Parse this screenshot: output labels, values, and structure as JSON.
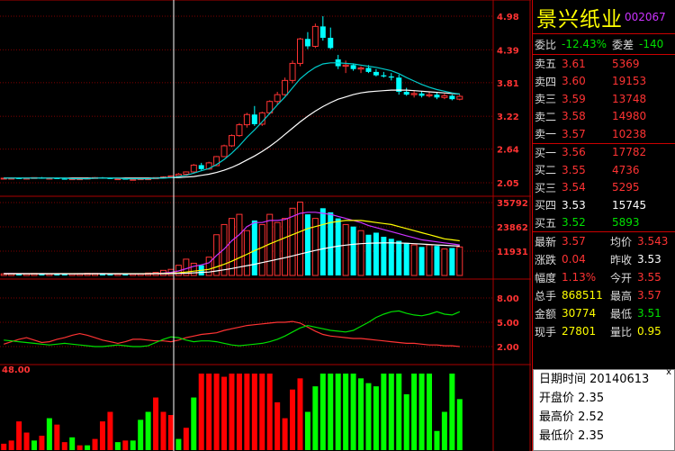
{
  "stock": {
    "name": "景兴纸业",
    "code": "002067"
  },
  "order_book": {
    "weibi_label": "委比",
    "weibi_value": "-12.43%",
    "weicha_label": "委差",
    "weicha_value": "-140",
    "asks": [
      {
        "label": "卖五",
        "price": "3.61",
        "volume": "5369"
      },
      {
        "label": "卖四",
        "price": "3.60",
        "volume": "19153"
      },
      {
        "label": "卖三",
        "price": "3.59",
        "volume": "13748"
      },
      {
        "label": "卖二",
        "price": "3.58",
        "volume": "14980"
      },
      {
        "label": "卖一",
        "price": "3.57",
        "volume": "10238"
      }
    ],
    "bids": [
      {
        "label": "买一",
        "price": "3.56",
        "volume": "17782"
      },
      {
        "label": "买二",
        "price": "3.55",
        "volume": "4736"
      },
      {
        "label": "买三",
        "price": "3.54",
        "volume": "5295"
      },
      {
        "label": "买四",
        "price": "3.53",
        "volume": "15745"
      },
      {
        "label": "买五",
        "price": "3.52",
        "volume": "5893"
      }
    ]
  },
  "quote": [
    {
      "l1": "最新",
      "v1": "3.57",
      "l2": "均价",
      "v2": "3.543"
    },
    {
      "l1": "涨跌",
      "v1": "0.04",
      "l2": "昨收",
      "v2": "3.53"
    },
    {
      "l1": "幅度",
      "v1": "1.13%",
      "l2": "今开",
      "v2": "3.55"
    },
    {
      "l1": "总手",
      "v1": "868511",
      "l2": "最高",
      "v2": "3.57"
    },
    {
      "l1": "金额",
      "v1": "30774",
      "l2": "最低",
      "v2": "3.51"
    },
    {
      "l1": "现手",
      "v1": "27801",
      "l2": "量比",
      "v2": "0.95"
    }
  ],
  "tooltip": {
    "date_label": "日期时间",
    "date_value": "20140613",
    "open_label": "开盘价",
    "open_value": "2.35",
    "high_label": "最高价",
    "high_value": "2.52",
    "low_label": "最低价",
    "low_value": "2.35",
    "close_button": "x"
  },
  "colors": {
    "up": "#ff3333",
    "down": "#00ffff",
    "grid": "#aa0000",
    "axis_text": "#ff3333",
    "ma_slow": "#ffffff",
    "ma_fast": "#00cccc"
  },
  "chart_data": [
    {
      "type": "candlestick",
      "name": "price",
      "y_ticks": [
        "4.98",
        "4.39",
        "3.81",
        "3.22",
        "2.64",
        "2.05"
      ],
      "ylim": [
        2.05,
        4.98
      ],
      "candles": [
        [
          2.12,
          2.13,
          2.11,
          2.13
        ],
        [
          2.13,
          2.14,
          2.12,
          2.13
        ],
        [
          2.13,
          2.14,
          2.12,
          2.12
        ],
        [
          2.12,
          2.13,
          2.11,
          2.13
        ],
        [
          2.13,
          2.14,
          2.12,
          2.14
        ],
        [
          2.14,
          2.15,
          2.12,
          2.12
        ],
        [
          2.12,
          2.14,
          2.11,
          2.13
        ],
        [
          2.13,
          2.14,
          2.12,
          2.12
        ],
        [
          2.12,
          2.13,
          2.11,
          2.11
        ],
        [
          2.11,
          2.13,
          2.1,
          2.12
        ],
        [
          2.12,
          2.13,
          2.11,
          2.12
        ],
        [
          2.12,
          2.14,
          2.11,
          2.13
        ],
        [
          2.13,
          2.15,
          2.12,
          2.14
        ],
        [
          2.14,
          2.15,
          2.12,
          2.13
        ],
        [
          2.13,
          2.14,
          2.12,
          2.12
        ],
        [
          2.12,
          2.13,
          2.11,
          2.12
        ],
        [
          2.12,
          2.13,
          2.11,
          2.11
        ],
        [
          2.11,
          2.12,
          2.1,
          2.11
        ],
        [
          2.11,
          2.12,
          2.1,
          2.12
        ],
        [
          2.12,
          2.13,
          2.11,
          2.12
        ],
        [
          2.12,
          2.14,
          2.12,
          2.14
        ],
        [
          2.14,
          2.16,
          2.13,
          2.15
        ],
        [
          2.15,
          2.18,
          2.14,
          2.17
        ],
        [
          2.17,
          2.22,
          2.16,
          2.2
        ],
        [
          2.2,
          2.25,
          2.19,
          2.24
        ],
        [
          2.24,
          2.38,
          2.22,
          2.36
        ],
        [
          2.36,
          2.4,
          2.27,
          2.29
        ],
        [
          2.29,
          2.42,
          2.28,
          2.4
        ],
        [
          2.35,
          2.52,
          2.35,
          2.51
        ],
        [
          2.51,
          2.72,
          2.5,
          2.7
        ],
        [
          2.7,
          2.9,
          2.68,
          2.88
        ],
        [
          2.88,
          3.1,
          2.86,
          3.07
        ],
        [
          3.07,
          3.28,
          3.02,
          3.25
        ],
        [
          3.25,
          3.4,
          3.05,
          3.08
        ],
        [
          3.08,
          3.3,
          3.05,
          3.28
        ],
        [
          3.28,
          3.5,
          3.25,
          3.48
        ],
        [
          3.48,
          3.65,
          3.42,
          3.6
        ],
        [
          3.6,
          3.9,
          3.58,
          3.85
        ],
        [
          3.85,
          4.2,
          3.8,
          4.15
        ],
        [
          4.15,
          4.6,
          4.1,
          4.58
        ],
        [
          4.58,
          4.7,
          4.4,
          4.45
        ],
        [
          4.45,
          4.85,
          4.42,
          4.8
        ],
        [
          4.8,
          4.98,
          4.55,
          4.6
        ],
        [
          4.6,
          4.78,
          4.4,
          4.42
        ],
        [
          4.22,
          4.3,
          4.05,
          4.1
        ],
        [
          4.1,
          4.2,
          3.98,
          4.12
        ],
        [
          4.12,
          4.15,
          4.02,
          4.05
        ],
        [
          4.05,
          4.1,
          3.98,
          4.07
        ],
        [
          4.07,
          4.12,
          3.98,
          4.0
        ],
        [
          4.0,
          4.05,
          3.92,
          3.94
        ],
        [
          3.94,
          4.0,
          3.9,
          3.92
        ],
        [
          3.92,
          3.98,
          3.85,
          3.9
        ],
        [
          3.9,
          3.95,
          3.6,
          3.65
        ],
        [
          3.65,
          3.72,
          3.58,
          3.6
        ],
        [
          3.6,
          3.68,
          3.55,
          3.62
        ],
        [
          3.62,
          3.66,
          3.55,
          3.58
        ],
        [
          3.58,
          3.65,
          3.55,
          3.6
        ],
        [
          3.6,
          3.64,
          3.52,
          3.55
        ],
        [
          3.55,
          3.62,
          3.52,
          3.58
        ],
        [
          3.58,
          3.6,
          3.5,
          3.52
        ],
        [
          3.52,
          3.6,
          3.5,
          3.57
        ]
      ],
      "ma_slow": [
        2.13,
        2.13,
        2.13,
        2.13,
        2.13,
        2.13,
        2.13,
        2.13,
        2.13,
        2.13,
        2.13,
        2.13,
        2.13,
        2.13,
        2.13,
        2.13,
        2.13,
        2.13,
        2.13,
        2.13,
        2.13,
        2.14,
        2.14,
        2.14,
        2.15,
        2.16,
        2.18,
        2.2,
        2.23,
        2.27,
        2.32,
        2.38,
        2.45,
        2.52,
        2.6,
        2.69,
        2.79,
        2.9,
        3.01,
        3.12,
        3.22,
        3.31,
        3.39,
        3.46,
        3.52,
        3.56,
        3.6,
        3.63,
        3.65,
        3.66,
        3.67,
        3.68,
        3.68,
        3.68,
        3.67,
        3.66,
        3.65,
        3.64,
        3.63,
        3.62,
        3.61
      ],
      "ma_fast": [
        2.13,
        2.13,
        2.13,
        2.13,
        2.13,
        2.13,
        2.13,
        2.13,
        2.13,
        2.12,
        2.12,
        2.12,
        2.13,
        2.13,
        2.13,
        2.13,
        2.12,
        2.12,
        2.12,
        2.12,
        2.13,
        2.13,
        2.14,
        2.16,
        2.18,
        2.22,
        2.26,
        2.3,
        2.37,
        2.46,
        2.57,
        2.7,
        2.85,
        2.98,
        3.12,
        3.27,
        3.42,
        3.56,
        3.72,
        3.88,
        3.99,
        4.08,
        4.14,
        4.16,
        4.16,
        4.15,
        4.14,
        4.12,
        4.1,
        4.08,
        4.05,
        4.02,
        3.97,
        3.9,
        3.84,
        3.78,
        3.73,
        3.69,
        3.66,
        3.63,
        3.61
      ]
    },
    {
      "type": "bar",
      "name": "volume",
      "y_ticks": [
        "35792",
        "23862",
        "11931"
      ],
      "ylim": [
        0,
        35792
      ],
      "values": [
        800,
        900,
        700,
        850,
        1000,
        900,
        800,
        750,
        700,
        900,
        800,
        1100,
        1000,
        900,
        800,
        700,
        750,
        800,
        900,
        1200,
        1500,
        2500,
        3000,
        5000,
        8000,
        6000,
        5000,
        9000,
        20000,
        25000,
        28000,
        30000,
        22000,
        27000,
        25000,
        30000,
        26000,
        28000,
        33000,
        36000,
        30000,
        28000,
        33000,
        31000,
        28000,
        25000,
        24000,
        22000,
        20000,
        21000,
        19000,
        18000,
        17000,
        16000,
        15000,
        14000,
        15000,
        14500,
        13000,
        13500,
        14000
      ],
      "ma1": [
        1000,
        1000,
        950,
        950,
        900,
        950,
        900,
        900,
        900,
        850,
        900,
        900,
        950,
        950,
        900,
        900,
        850,
        850,
        850,
        900,
        1000,
        1200,
        1500,
        2200,
        3300,
        4500,
        5200,
        6200,
        9800,
        13000,
        17000,
        20000,
        24000,
        26000,
        26000,
        27000,
        27000,
        27500,
        29000,
        30500,
        31000,
        31000,
        30500,
        30000,
        29000,
        28000,
        27000,
        26000,
        24500,
        23500,
        22500,
        21500,
        20500,
        19500,
        18500,
        17500,
        17000,
        16500,
        16000,
        15500,
        15000
      ],
      "ma2": [
        900,
        900,
        900,
        900,
        900,
        900,
        900,
        900,
        900,
        900,
        900,
        900,
        900,
        900,
        900,
        900,
        900,
        900,
        900,
        900,
        950,
        1000,
        1100,
        1300,
        1700,
        2100,
        2500,
        3000,
        4200,
        5500,
        7000,
        8700,
        10400,
        12200,
        13800,
        15500,
        17000,
        18500,
        20000,
        21500,
        23000,
        24000,
        25000,
        26000,
        26500,
        27000,
        27000,
        27000,
        26500,
        26000,
        25500,
        25000,
        24000,
        23000,
        22000,
        21000,
        20000,
        19000,
        18000,
        17500,
        17000
      ],
      "ma3": [
        850,
        850,
        850,
        850,
        850,
        850,
        850,
        850,
        850,
        850,
        850,
        850,
        850,
        850,
        850,
        850,
        850,
        850,
        850,
        850,
        870,
        900,
        950,
        1000,
        1100,
        1300,
        1500,
        1700,
        2200,
        2800,
        3400,
        4100,
        4800,
        5500,
        6300,
        7100,
        7900,
        8700,
        9600,
        10500,
        11400,
        12300,
        13100,
        13800,
        14400,
        14900,
        15300,
        15600,
        15800,
        15900,
        16000,
        16000,
        15900,
        15800,
        15600,
        15400,
        15200,
        15000,
        14800,
        14600,
        14400
      ]
    },
    {
      "type": "line",
      "name": "indicator",
      "y_ticks": [
        "8.00",
        "5.00",
        "2.00"
      ],
      "ylim": [
        0,
        10
      ],
      "series": [
        {
          "values": [
            2.3,
            2.6,
            2.9,
            3.1,
            2.8,
            2.5,
            2.6,
            2.9,
            3.1,
            3.4,
            3.6,
            3.4,
            3.1,
            2.8,
            2.6,
            2.4,
            2.6,
            2.9,
            2.9,
            2.8,
            2.7,
            2.7,
            2.6,
            2.8,
            3.1,
            3.3,
            3.5,
            3.6,
            3.7,
            4.0,
            4.2,
            4.4,
            4.6,
            4.7,
            4.8,
            4.9,
            5.0,
            5.0,
            5.1,
            4.9,
            4.4,
            3.9,
            3.5,
            3.3,
            3.2,
            3.1,
            3.0,
            3.0,
            2.9,
            2.8,
            2.7,
            2.6,
            2.5,
            2.4,
            2.4,
            2.3,
            2.2,
            2.2,
            2.1,
            2.1,
            2.0
          ],
          "color": "#ff3333"
        },
        {
          "values": [
            2.8,
            2.7,
            2.6,
            2.5,
            2.4,
            2.3,
            2.2,
            2.3,
            2.4,
            2.3,
            2.2,
            2.1,
            2.0,
            2.0,
            2.1,
            2.2,
            2.1,
            2.0,
            2.0,
            2.1,
            2.5,
            2.9,
            3.2,
            3.1,
            2.8,
            2.6,
            2.7,
            2.7,
            2.6,
            2.4,
            2.2,
            2.1,
            2.2,
            2.3,
            2.4,
            2.6,
            2.9,
            3.3,
            3.8,
            4.3,
            4.6,
            4.4,
            4.2,
            4.0,
            3.9,
            3.8,
            4.0,
            4.5,
            5.0,
            5.6,
            6.0,
            6.3,
            6.4,
            6.1,
            5.9,
            5.8,
            6.0,
            6.3,
            6.0,
            5.9,
            6.3
          ],
          "color": "#00e000"
        }
      ]
    },
    {
      "type": "bar",
      "name": "signal",
      "y_ticks": [
        "48.00"
      ],
      "ylim": [
        0,
        48
      ],
      "values": [
        4,
        6,
        18,
        11,
        6,
        9,
        20,
        16,
        5,
        8,
        3,
        3,
        7,
        18,
        24,
        5,
        6,
        6,
        19,
        24,
        33,
        24,
        22,
        7,
        14,
        33,
        48,
        48,
        48,
        46,
        48,
        48,
        48,
        48,
        48,
        48,
        30,
        20,
        38,
        45,
        24,
        40,
        48,
        48,
        48,
        48,
        48,
        45,
        42,
        40,
        48,
        48,
        48,
        35,
        48,
        48,
        48,
        12,
        24,
        48,
        32
      ],
      "colors": [
        "red",
        "red",
        "red",
        "red",
        "green",
        "red",
        "green",
        "red",
        "red",
        "green",
        "red",
        "green",
        "red",
        "red",
        "red",
        "green",
        "red",
        "green",
        "green",
        "green",
        "red",
        "red",
        "red",
        "green",
        "red",
        "green",
        "red",
        "red",
        "red",
        "red",
        "red",
        "red",
        "red",
        "red",
        "red",
        "red",
        "red",
        "red",
        "red",
        "red",
        "green",
        "green",
        "green",
        "green",
        "green",
        "green",
        "green",
        "green",
        "green",
        "green",
        "green",
        "green",
        "green",
        "green",
        "green",
        "green",
        "green",
        "green",
        "green",
        "green",
        "green"
      ]
    }
  ]
}
